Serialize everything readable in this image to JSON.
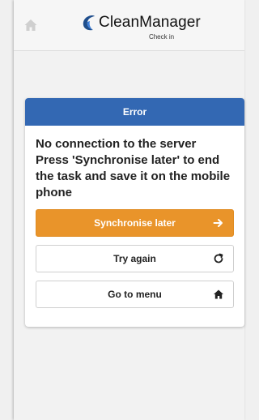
{
  "app": {
    "brand": "CleanManager",
    "subtitle": "Check in"
  },
  "dialog": {
    "title": "Error",
    "message": "No connection to the server\nPress 'Synchronise later' to end the task and save it on the mobile phone",
    "buttons": {
      "sync_later": "Synchronise later",
      "try_again": "Try again",
      "go_to_menu": "Go to menu"
    }
  },
  "colors": {
    "header_blue": "#3368b3",
    "primary_orange": "#e9942a"
  },
  "icons": {
    "home": "home-icon",
    "arrow": "arrow-right-icon",
    "refresh": "refresh-icon"
  }
}
